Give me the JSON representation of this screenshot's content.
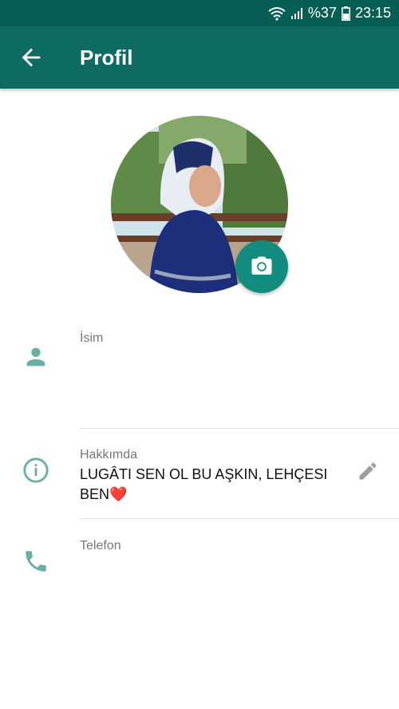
{
  "status_bar": {
    "battery_text": "%37",
    "time": "23:15",
    "wifi_icon": "wifi-icon",
    "signal_icon": "signal-icon",
    "battery_icon": "battery-icon"
  },
  "app_bar": {
    "title": "Profil",
    "back_icon": "arrow-back-icon"
  },
  "profile": {
    "avatar_icon": "avatar",
    "camera_icon": "camera-icon"
  },
  "fields": {
    "name": {
      "label": "İsim",
      "icon": "person-icon"
    },
    "about": {
      "label": "Hakkımda",
      "value_line1": "LUGÂTI SEN OL BU AŞKIN, LEHÇESI",
      "value_line2": "BEN",
      "value_emoji": "❤️",
      "icon": "info-icon",
      "edit_icon": "pencil-icon"
    },
    "phone": {
      "label": "Telefon",
      "icon": "phone-icon"
    }
  },
  "colors": {
    "status_bar": "#075e54",
    "app_bar": "#0e6b61",
    "accent": "#128c7e",
    "icon": "#6aaea5"
  }
}
